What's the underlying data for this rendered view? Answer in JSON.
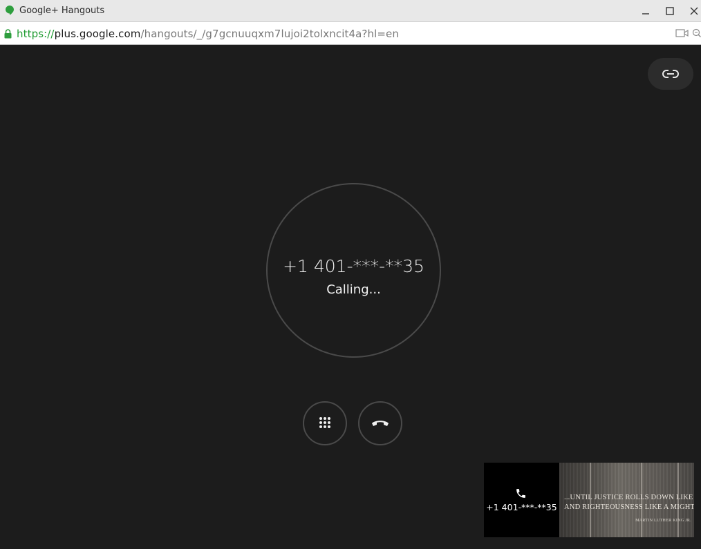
{
  "window": {
    "title": "Google+ Hangouts"
  },
  "address_bar": {
    "url_scheme": "https://",
    "url_domain": "plus.google.com",
    "url_path": "/hangouts/_/g7gcnuuqxm7lujoi2tolxncit4a?hl=en"
  },
  "call": {
    "phone_number": "+1 401-***-**35",
    "status": "Calling..."
  },
  "filmstrip": {
    "participant_number": "+1 401-***-**35",
    "self_video_text": {
      "line1": "...UNTIL JUSTICE ROLLS DOWN LIKE WATERS",
      "line2": "AND RIGHTEOUSNESS LIKE A MIGHTY STREAM",
      "attribution": "MARTIN LUTHER KING JR."
    }
  },
  "icons": {
    "app": "hangouts-icon",
    "lock": "lock-icon",
    "link": "link-icon",
    "dialpad": "dialpad-icon",
    "hangup": "hangup-icon",
    "participant": "phone-icon"
  },
  "colors": {
    "background": "#1c1c1c",
    "url_secure": "#1e9b30",
    "hangouts_green": "#2e9e3e"
  }
}
